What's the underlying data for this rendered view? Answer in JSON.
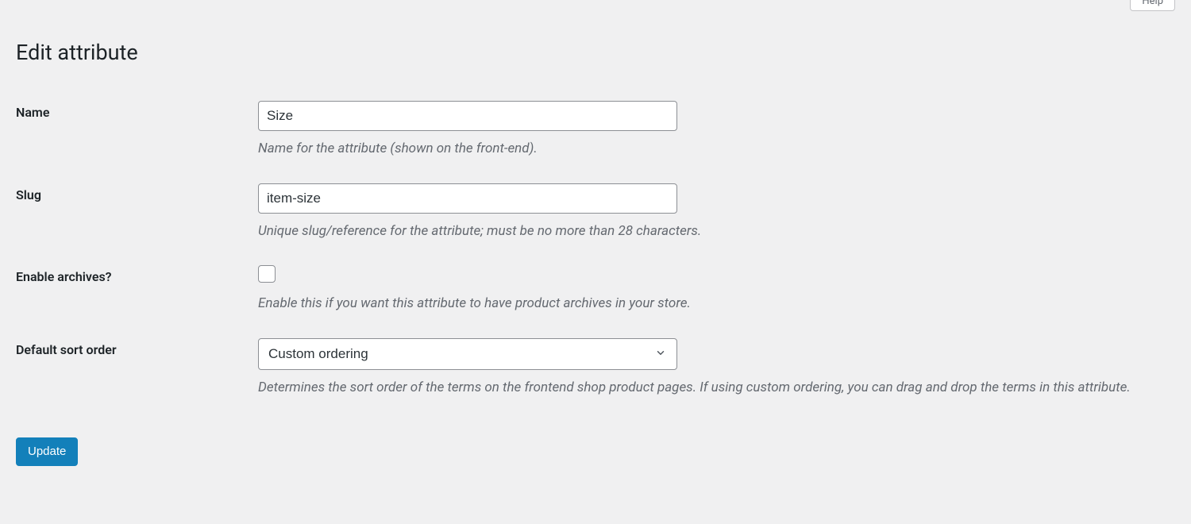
{
  "header": {
    "help_tab": "Help",
    "page_title": "Edit attribute"
  },
  "form": {
    "name": {
      "label": "Name",
      "value": "Size",
      "description": "Name for the attribute (shown on the front-end)."
    },
    "slug": {
      "label": "Slug",
      "value": "item-size",
      "description": "Unique slug/reference for the attribute; must be no more than 28 characters."
    },
    "archives": {
      "label": "Enable archives?",
      "checked": false,
      "description": "Enable this if you want this attribute to have product archives in your store."
    },
    "sort_order": {
      "label": "Default sort order",
      "selected": "Custom ordering",
      "description": "Determines the sort order of the terms on the frontend shop product pages. If using custom ordering, you can drag and drop the terms in this attribute."
    },
    "submit_label": "Update"
  }
}
